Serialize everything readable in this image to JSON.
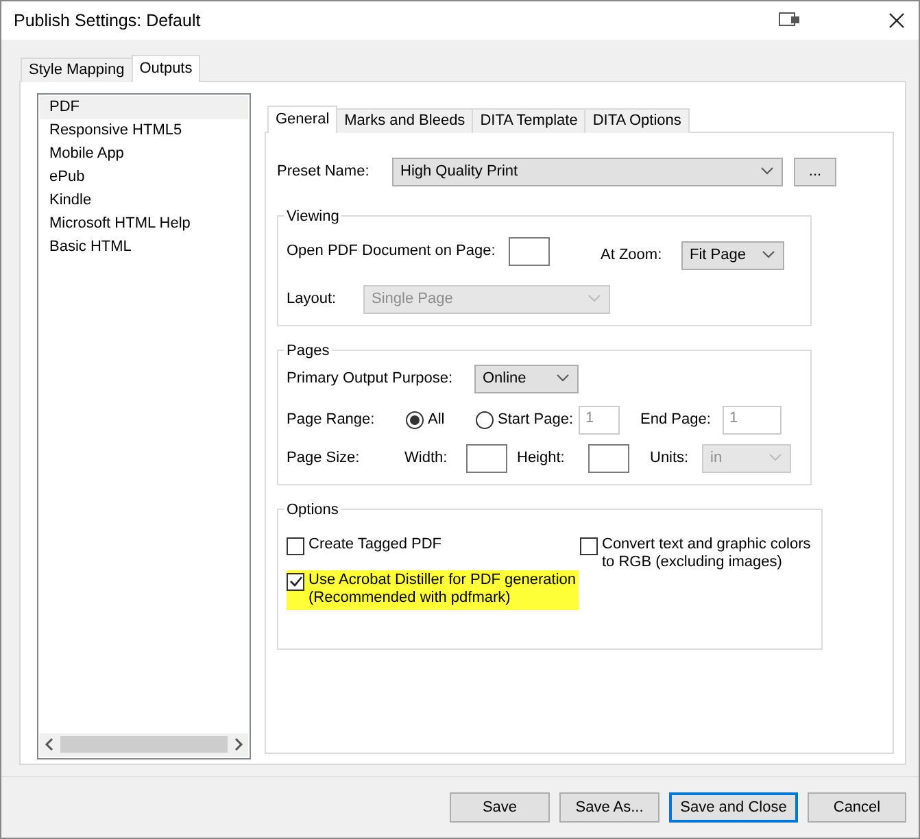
{
  "window": {
    "title": "Publish Settings: Default"
  },
  "outer_tabs": [
    {
      "label": "Style Mapping",
      "selected": false
    },
    {
      "label": "Outputs",
      "selected": true
    }
  ],
  "outputs": [
    {
      "label": "PDF",
      "selected": true
    },
    {
      "label": "Responsive HTML5",
      "selected": false
    },
    {
      "label": "Mobile App",
      "selected": false
    },
    {
      "label": "ePub",
      "selected": false
    },
    {
      "label": "Kindle",
      "selected": false
    },
    {
      "label": "Microsoft HTML Help",
      "selected": false
    },
    {
      "label": "Basic HTML",
      "selected": false
    }
  ],
  "inner_tabs": [
    {
      "label": "General",
      "selected": true
    },
    {
      "label": "Marks and Bleeds",
      "selected": false
    },
    {
      "label": "DITA Template",
      "selected": false
    },
    {
      "label": "DITA Options",
      "selected": false
    }
  ],
  "preset": {
    "label": "Preset Name:",
    "value": "High Quality Print",
    "browse": "..."
  },
  "viewing": {
    "title": "Viewing",
    "open_page": {
      "label": "Open PDF Document on Page:"
    },
    "zoom": {
      "label": "At Zoom:",
      "value": "Fit Page",
      "disabled": false
    },
    "layout": {
      "label": "Layout:",
      "value": "Single Page",
      "disabled": true
    }
  },
  "pages": {
    "title": "Pages",
    "purpose": {
      "label": "Primary Output Purpose:",
      "value": "Online",
      "disabled": false
    },
    "range": {
      "label": "Page Range:",
      "options": [
        {
          "label": "All",
          "selected": true
        },
        {
          "label": "Start Page:",
          "selected": false
        }
      ],
      "start_value": "1",
      "start_disabled": true,
      "end_label": "End Page:",
      "end_value": "1",
      "end_disabled": true
    },
    "size": {
      "label": "Page Size:",
      "width_label": "Width:",
      "height_label": "Height:",
      "units_label": "Units:",
      "units_value": "in",
      "units_disabled": true
    }
  },
  "options": {
    "title": "Options",
    "left": [
      {
        "label": "Create Tagged PDF",
        "checked": false,
        "highlighted": false
      },
      {
        "label": "Use Acrobat Distiller for PDF generation\n(Recommended with pdfmark)",
        "checked": true,
        "highlighted": true
      }
    ],
    "right": [
      {
        "label": "Convert text and graphic colors\nto RGB (excluding images)",
        "checked": false,
        "highlighted": false
      }
    ]
  },
  "buttons": [
    {
      "label": "Save",
      "default": false
    },
    {
      "label": "Save As...",
      "default": false
    },
    {
      "label": "Save and Close",
      "default": true
    },
    {
      "label": "Cancel",
      "default": false
    }
  ]
}
